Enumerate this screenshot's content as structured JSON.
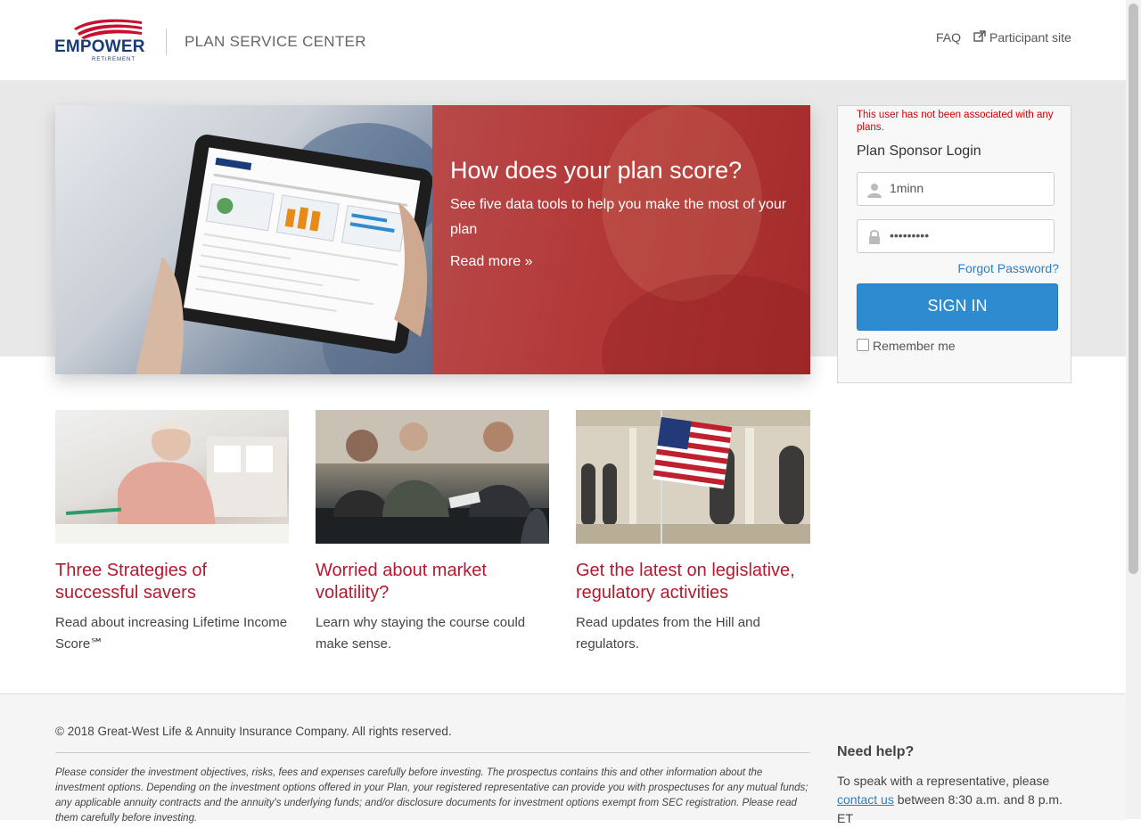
{
  "header": {
    "logo_word": "EMPOWER",
    "logo_sub": "RETIREMENT",
    "site_title": "PLAN SERVICE CENTER",
    "faq": "FAQ",
    "participant": "Participant site"
  },
  "hero": {
    "title": "How does your plan score?",
    "text": "See five data tools to help you make the most of your plan",
    "link": "Read more »"
  },
  "login": {
    "error": "This user has not been associated with any plans.",
    "title": "Plan Sponsor Login",
    "username": "1minn",
    "password": "•••••••••",
    "forgot": "Forgot Password?",
    "signin": "SIGN IN",
    "remember": "Remember me",
    "remember_checked": false
  },
  "cards": [
    {
      "title": "Three Strategies of successful savers",
      "desc": "Read about increasing Lifetime Income Score℠"
    },
    {
      "title": "Worried about market volatility?",
      "desc": "Learn why staying the course could make sense."
    },
    {
      "title": "Get the latest on legislative, regulatory activities",
      "desc": "Read updates from the Hill and regulators."
    }
  ],
  "footer": {
    "copyright": "© 2018 Great-West Life & Annuity Insurance Company. All rights reserved.",
    "disclaimer": "Please consider the investment objectives, risks, fees and expenses carefully before investing. The prospectus contains this and other information about the investment options. Depending on the investment options offered in your Plan, your registered representative can provide you with prospectuses for any mutual funds; any applicable annuity contracts and the annuity's underlying funds; and/or disclosure documents for investment options exempt from SEC registration. Please read them carefully before investing.",
    "help_title": "Need help?",
    "help_before": "To speak with a representative, please ",
    "help_link": "contact us",
    "help_after": " between 8:30 a.m. and 8 p.m. ET"
  },
  "colors": {
    "brand": "#1a3b7a",
    "accent_red": "#b5192f",
    "button_blue": "#2e8bd0",
    "link_blue": "#2d7ec4",
    "error_red": "#d10000",
    "hero_red": "#b43a3a"
  }
}
